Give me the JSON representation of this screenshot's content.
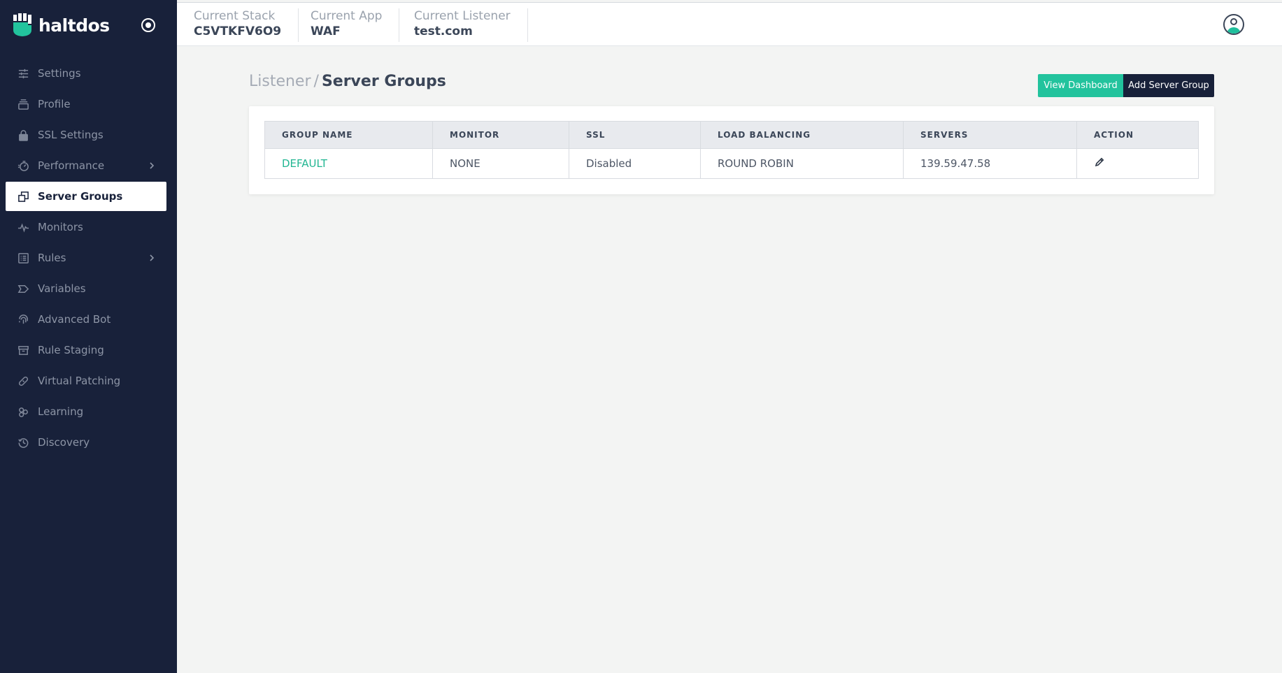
{
  "brand": {
    "name": "haltdos",
    "accent": "#22c39d",
    "sidebar_bg": "#18213a"
  },
  "sidebar": {
    "items": [
      {
        "label": "Settings",
        "icon": "sliders-icon",
        "active": false,
        "has_chevron": false
      },
      {
        "label": "Profile",
        "icon": "profile-stack-icon",
        "active": false,
        "has_chevron": false
      },
      {
        "label": "SSL Settings",
        "icon": "lock-icon",
        "active": false,
        "has_chevron": false
      },
      {
        "label": "Performance",
        "icon": "gauge-icon",
        "active": false,
        "has_chevron": true
      },
      {
        "label": "Server Groups",
        "icon": "copy-icon",
        "active": true,
        "has_chevron": false
      },
      {
        "label": "Monitors",
        "icon": "pulse-icon",
        "active": false,
        "has_chevron": false
      },
      {
        "label": "Rules",
        "icon": "list-icon",
        "active": false,
        "has_chevron": true
      },
      {
        "label": "Variables",
        "icon": "tag-icon",
        "active": false,
        "has_chevron": false
      },
      {
        "label": "Advanced Bot",
        "icon": "fingerprint-icon",
        "active": false,
        "has_chevron": false
      },
      {
        "label": "Rule Staging",
        "icon": "archive-icon",
        "active": false,
        "has_chevron": false
      },
      {
        "label": "Virtual Patching",
        "icon": "bandage-icon",
        "active": false,
        "has_chevron": false
      },
      {
        "label": "Learning",
        "icon": "learning-icon",
        "active": false,
        "has_chevron": false
      },
      {
        "label": "Discovery",
        "icon": "history-icon",
        "active": false,
        "has_chevron": false
      }
    ]
  },
  "header": {
    "stack": {
      "caption": "Current Stack",
      "value": "C5VTKFV6O9"
    },
    "app": {
      "caption": "Current App",
      "value": "WAF"
    },
    "listener": {
      "caption": "Current Listener",
      "value": "test.com"
    }
  },
  "breadcrumb": {
    "root": "Listener",
    "separator": "/",
    "current": "Server Groups"
  },
  "actions": {
    "view_dashboard": "View Dashboard",
    "add_server_group": "Add Server Group"
  },
  "table": {
    "columns": [
      "GROUP NAME",
      "MONITOR",
      "SSL",
      "LOAD BALANCING",
      "SERVERS",
      "ACTION"
    ],
    "rows": [
      {
        "group_name": "DEFAULT",
        "monitor": "NONE",
        "ssl": "Disabled",
        "load_balancing": "ROUND ROBIN",
        "servers": "139.59.47.58",
        "action_icon": "pencil-icon"
      }
    ]
  }
}
